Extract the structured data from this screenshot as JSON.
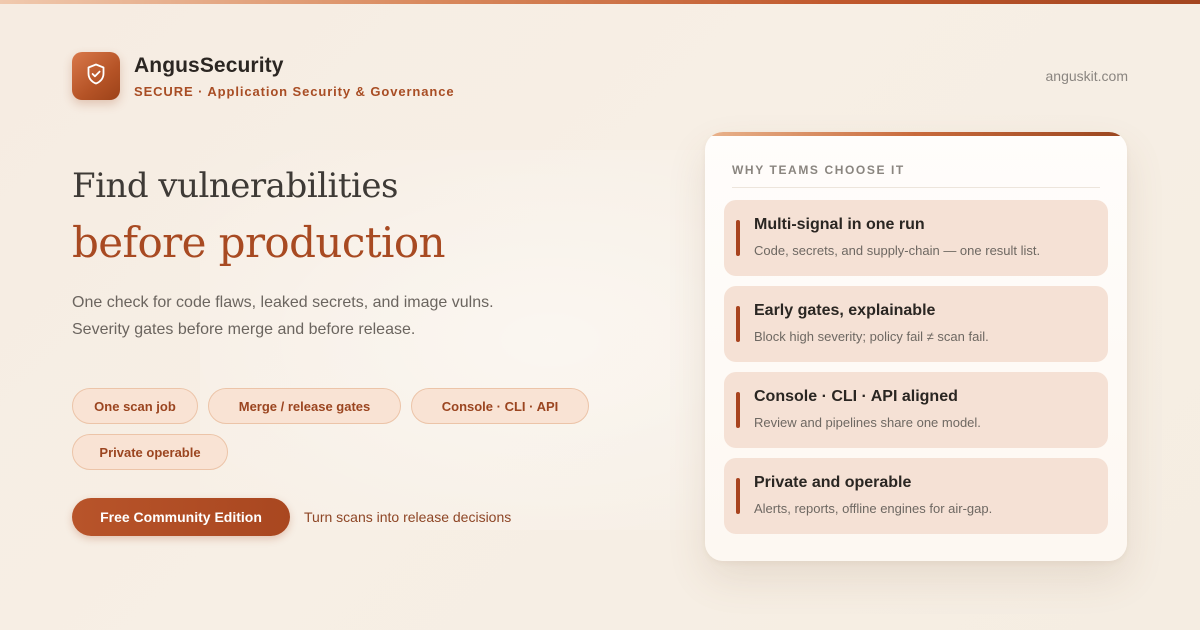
{
  "brand": {
    "name": "AngusSecurity",
    "tagline": "SECURE · Application Security & Governance",
    "logo_icon": "shield-check-icon",
    "site": "anguskit.com"
  },
  "hero": {
    "line1": "Find vulnerabilities",
    "line2": "before production",
    "sub1": "One check for code flaws, leaked secrets, and image vulns.",
    "sub2": "Severity gates before merge and before release."
  },
  "chips": [
    "One scan job",
    "Merge / release gates",
    "Console · CLI · API",
    "Private operable"
  ],
  "cta": {
    "label": "Free Community Edition",
    "note": "Turn scans into release decisions"
  },
  "panel": {
    "title": "WHY TEAMS CHOOSE IT",
    "cards": [
      {
        "title": "Multi-signal in one run",
        "desc": "Code, secrets, and supply-chain — one result list."
      },
      {
        "title": "Early gates, explainable",
        "desc": "Block high severity; policy fail ≠ scan fail."
      },
      {
        "title": "Console · CLI · API aligned",
        "desc": "Review and pipelines share one model."
      },
      {
        "title": "Private and operable",
        "desc": "Alerts, reports, offline engines for air-gap."
      }
    ]
  },
  "colors": {
    "accent": "#a84a22",
    "accent_dark": "#a8431e",
    "chip_bg": "#f9e3d4",
    "card_bg": "#f5e1d5",
    "page_bg": "#f6ece2"
  }
}
